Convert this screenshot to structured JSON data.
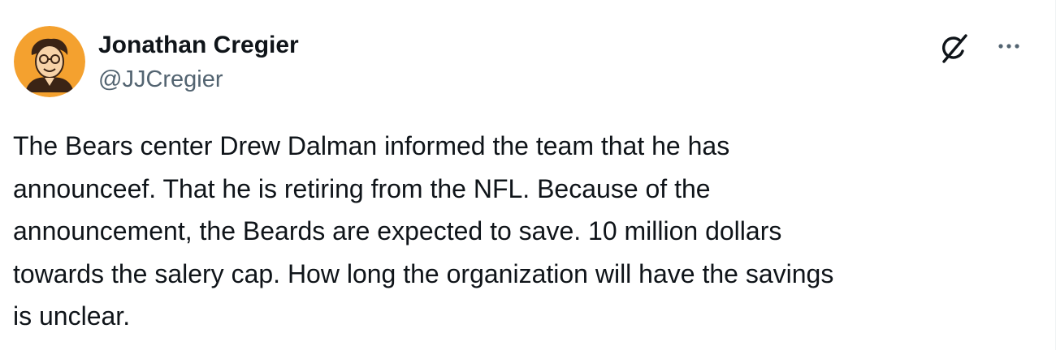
{
  "author": {
    "name": "Jonathan Cregier",
    "handle": "@JJCregier",
    "avatar_icon": "caricature-portrait-avatar",
    "avatar_background": "#f4a12f"
  },
  "actions": {
    "grok_icon": "grok-icon",
    "more_icon": "more-horizontal-icon"
  },
  "tweet": {
    "lines": [
      "The Bears center Drew Dalman informed the team that he has",
      "announceef. That he is retiring from the NFL. Because of the",
      "announcement, the Beards are expected to save. 10 million dollars",
      "towards the salery cap. How long the organization will have the savings",
      "is unclear."
    ]
  },
  "colors": {
    "text_primary": "#0f1419",
    "text_secondary": "#536471"
  }
}
